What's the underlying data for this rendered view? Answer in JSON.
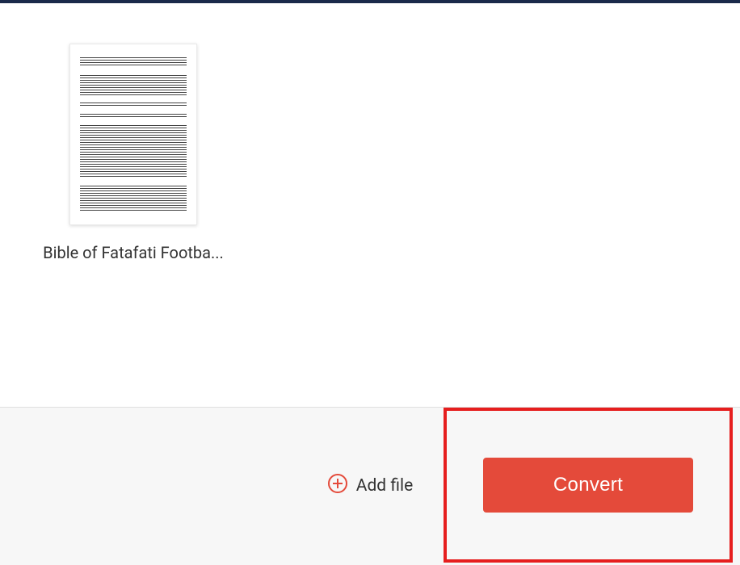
{
  "file": {
    "name": "Bible of Fatafati Footba..."
  },
  "actions": {
    "add_file_label": "Add file",
    "convert_label": "Convert"
  },
  "colors": {
    "accent": "#e44a3a",
    "highlight_border": "#e61e1e"
  }
}
